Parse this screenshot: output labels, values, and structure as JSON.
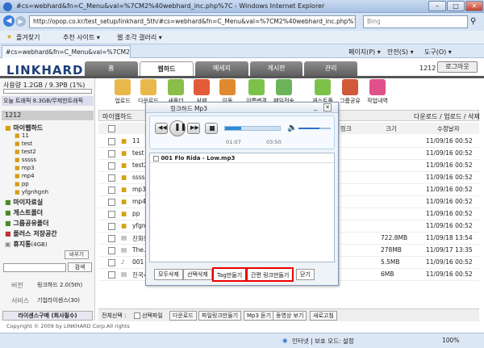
{
  "window": {
    "title": "#cs=webhard&fn=C_Menu&val=%7CM2%40webhard_inc.php%7C - Windows Internet Explorer",
    "url": "http://opop.co.kr/test_setup/linkhard_5th/#cs=webhard&fn=C_Menu&val=%7CM2%40webhard_inc.php%7C",
    "search_placeholder": "Bing"
  },
  "favorites": {
    "fav_label": "즐겨찾기",
    "suggested_sites": "추천 사이트 ▾",
    "web_slice": "웹 조각 갤러리 ▾"
  },
  "tab": {
    "label": "#cs=webhard&fn=C_Menu&val=%7CM2%40we..."
  },
  "ie_commands": [
    "페이지(P) ▾",
    "안전(S) ▾",
    "도구(O) ▾"
  ],
  "site": {
    "logo": "LINKHARD",
    "nav": [
      "홈",
      "웹하드",
      "메세지",
      "게시판",
      "관리"
    ],
    "user_id": "1212",
    "logout": "로그아웃"
  },
  "left": {
    "usage": "사용량 1.2GB / 9.3PB (1%)",
    "traffic": "오늘 트래픽 8.3GB/무제한트래픽",
    "root_id": "1212",
    "tree": [
      "마이웹하드",
      "11",
      "test",
      "test2",
      "sssss",
      "mp3",
      "mp4",
      "pp",
      "yfgnhgnh",
      "마이자료실",
      "게스트폴더",
      "그룹공유폴더",
      "플러스 저장공간",
      "휴지통"
    ],
    "trash_size": "(4GB)",
    "empty_btn": "비우기",
    "search_btn": "검색",
    "version_label": "버전",
    "version_value": "링크하드 2.0(5th)",
    "service_label": "서비스",
    "service_value": "기업라이센스(30)",
    "license_btn": "라이센스구매 (회사필수)"
  },
  "toolbar": {
    "items": [
      "업로드",
      "다운로드",
      "새폴더",
      "삭제",
      "이동",
      "이름변경",
      "메일전송",
      "게스트폴더",
      "그룹공유",
      "작업내역"
    ],
    "path": "마이웹하드",
    "right_label": "다운로드 / 업로드 / 삭제"
  },
  "files": {
    "headers": [
      "링크",
      "크기",
      "수정날자"
    ],
    "rows": [
      {
        "name": "11",
        "size": "",
        "date": "11/09/16 00:52"
      },
      {
        "name": "test",
        "size": "",
        "date": "11/09/16 00:52"
      },
      {
        "name": "test2",
        "size": "",
        "date": "11/09/16 00:52"
      },
      {
        "name": "sssss",
        "size": "",
        "date": "11/09/16 00:52"
      },
      {
        "name": "mp3",
        "size": "",
        "date": "11/09/16 00:52"
      },
      {
        "name": "mp4",
        "size": "",
        "date": "11/09/16 00:52"
      },
      {
        "name": "pp",
        "size": "",
        "date": "11/09/16 00:52"
      },
      {
        "name": "yfgnh",
        "size": "",
        "date": "11/09/16 00:52"
      },
      {
        "name": "진화의",
        "size": "722.8MB",
        "date": "11/09/18 13:54"
      },
      {
        "name": "The.Si",
        "size": "278MB",
        "date": "11/09/17 13:35"
      },
      {
        "name": "001 F",
        "size": "5.5MB",
        "date": "11/09/16 00:52"
      },
      {
        "name": "진국시",
        "size": "6MB",
        "date": "11/09/16 00:52"
      }
    ]
  },
  "bottom_actions": {
    "select_all": "전체선택 :",
    "select_file": "선택파일",
    "buttons": [
      "다운로드",
      "파일링크만들기",
      "Mp3 듣기",
      "동영상 보기",
      "새로고침"
    ]
  },
  "footer": "Copyright © 2009 by LINKHARD Corp.All rights",
  "status": {
    "zone": "인터넷 | 보호 모드: 설정",
    "zoom": "100%"
  },
  "modal": {
    "title": "링크하드 Mp3",
    "time_start": "01:07",
    "time_end": "03:50",
    "progress": 0.3,
    "volume": 0.65,
    "playlist": [
      "001 Flo Rida - Low.mp3"
    ],
    "buttons": [
      "모두삭제",
      "선택삭제",
      "Tag만들기",
      "간편 링크만들기",
      "닫기"
    ]
  }
}
